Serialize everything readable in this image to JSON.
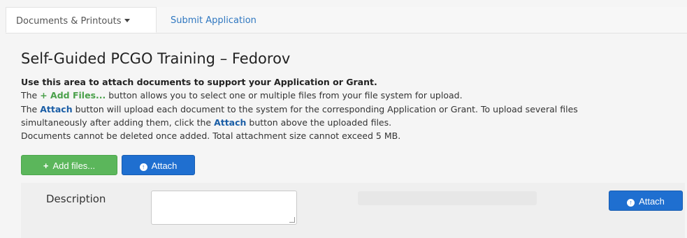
{
  "tabs": {
    "documents_printouts": "Documents & Printouts",
    "submit_application": "Submit Application"
  },
  "main": {
    "title": "Self-Guided PCGO Training – Fedorov",
    "lead": "Use this area to attach documents to support your Application or Grant.",
    "lines": [
      {
        "prefix": "The ",
        "highlight": "+ Add Files...",
        "suffix": " button allows you to select one or multiple files from your file system for upload."
      },
      {
        "prefix": "The ",
        "highlight": "Attach",
        "suffix": " button will upload each document to the system for the corresponding Application or Grant. To upload several files"
      },
      {
        "prefix": "simultaneously after adding them, click the ",
        "highlight": "Attach",
        "suffix": " button above the uploaded files."
      },
      {
        "text": "Documents cannot be deleted once added. Total attachment size cannot exceed 5 MB."
      }
    ]
  },
  "toolbar": {
    "add_files_label": "Add files...",
    "attach_label": "Attach"
  },
  "upload_row": {
    "description_label": "Description",
    "description_value": "",
    "attach_label": "Attach"
  }
}
